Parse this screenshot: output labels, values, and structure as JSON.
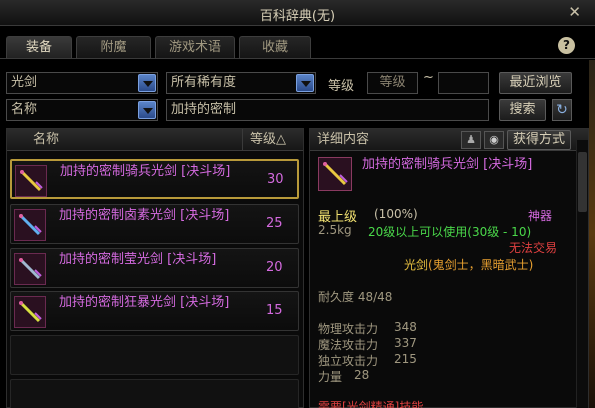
{
  "window": {
    "title": "百科辞典(无)",
    "close_glyph": "✕"
  },
  "tabs": [
    "装备",
    "附魔",
    "游戏术语",
    "收藏"
  ],
  "help_glyph": "?",
  "filters": {
    "type_value": "光剑",
    "rarity_value": "所有稀有度",
    "level_label": "等级",
    "level_placeholder": "等级",
    "tilde": "~",
    "recent_button": "最近浏览",
    "sort_value": "名称",
    "search_value": "加持的密制",
    "search_button": "搜索",
    "refresh_glyph": "↻"
  },
  "list": {
    "header_name": "名称",
    "header_level": "等级△",
    "rows": [
      {
        "name": "加持的密制骑兵光剑 [决斗场]",
        "level": "30"
      },
      {
        "name": "加持的密制卤素光剑 [决斗场]",
        "level": "25"
      },
      {
        "name": "加持的密制莹光剑 [决斗场]",
        "level": "20"
      },
      {
        "name": "加持的密制狂暴光剑 [决斗场]",
        "level": "15"
      }
    ]
  },
  "detail": {
    "header": "详细内容",
    "obtain_button": "获得方式",
    "item_name": "加持的密制骑兵光剑 [决斗场]",
    "grade": "最上级",
    "grade_pct": "(100%)",
    "rarity": "神器",
    "weight": "2.5kg",
    "level_req": "20级以上可以使用(30级 - 10)",
    "trade": "无法交易",
    "weapon_type": "光剑",
    "classes": "(鬼剑士，黑暗武士)",
    "durability": "耐久度 48/48",
    "stats": [
      {
        "label": "物理攻击力",
        "value": "348"
      },
      {
        "label": "魔法攻击力",
        "value": "337"
      },
      {
        "label": "独立攻击力",
        "value": "215"
      },
      {
        "label": "力量",
        "value": "28"
      }
    ],
    "footer_partial": "需要[光剑精通]技能"
  },
  "colors": {
    "accent": "#b89a3a",
    "epic": "#d46adf",
    "green": "#4ad84a",
    "orange": "#e8a030",
    "red": "#e04040"
  }
}
